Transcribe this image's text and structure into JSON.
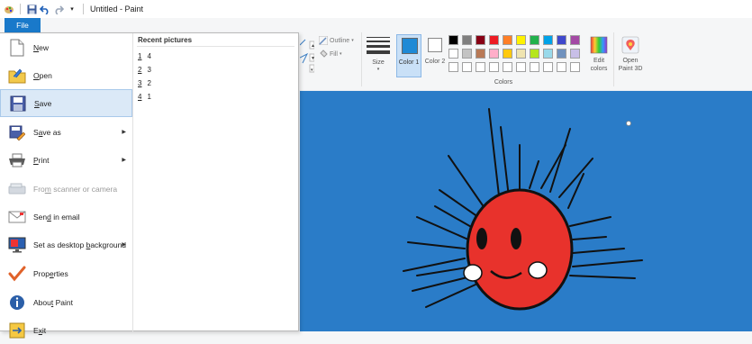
{
  "window": {
    "title": "Untitled - Paint"
  },
  "file_tab": {
    "label": "File"
  },
  "menu": {
    "commands": [
      {
        "label": "New",
        "accel": "N",
        "icon": "new-file-icon",
        "arrow": false
      },
      {
        "label": "Open",
        "accel": "O",
        "icon": "open-folder-icon",
        "arrow": false
      },
      {
        "label": "Save",
        "accel": "S",
        "icon": "save-disk-icon",
        "arrow": false
      },
      {
        "label": "Save as",
        "accel": "a",
        "icon": "save-as-icon",
        "arrow": true
      },
      {
        "label": "Print",
        "accel": "P",
        "icon": "printer-icon",
        "arrow": true
      },
      {
        "label": "From scanner or camera",
        "accel": "m",
        "icon": "scanner-icon",
        "arrow": false
      },
      {
        "label": "Send in email",
        "accel": "d",
        "icon": "email-icon",
        "arrow": false
      },
      {
        "label": "Set as desktop background",
        "accel": "b",
        "icon": "desktop-background-icon",
        "arrow": true
      },
      {
        "label": "Properties",
        "accel": "e",
        "icon": "checkmark-icon",
        "arrow": false
      },
      {
        "label": "About Paint",
        "accel": "t",
        "icon": "info-icon",
        "arrow": false
      },
      {
        "label": "Exit",
        "accel": "x",
        "icon": "exit-icon",
        "arrow": false
      }
    ],
    "recent_header": "Recent pictures",
    "recent": [
      {
        "num": "1",
        "name": "4"
      },
      {
        "num": "2",
        "name": "3"
      },
      {
        "num": "3",
        "name": "2"
      },
      {
        "num": "4",
        "name": "1"
      }
    ]
  },
  "ribbon": {
    "outline_label": "Outline",
    "fill_label": "Fill",
    "size_label": "Size",
    "color1_label": "Color 1",
    "color2_label": "Color 2",
    "colors_group_label": "Colors",
    "edit_colors_label": "Edit colors",
    "open_paint3d_label": "Open Paint 3D",
    "color1": "#1f8ad6",
    "color2": "#ffffff",
    "palette_row1": [
      "#000000",
      "#7f7f7f",
      "#880015",
      "#ed1c24",
      "#ff7f27",
      "#fff200",
      "#22b14c",
      "#00a2e8",
      "#3f48cc",
      "#a349a4"
    ],
    "palette_row2": [
      "#ffffff",
      "#c3c3c3",
      "#b97a57",
      "#ffaec9",
      "#ffc90e",
      "#efe4b0",
      "#b5e61d",
      "#99d9ea",
      "#7092be",
      "#c8bfe7"
    ]
  },
  "canvas": {
    "background": "#2a7cc8",
    "sun_color": "#e8322c"
  }
}
